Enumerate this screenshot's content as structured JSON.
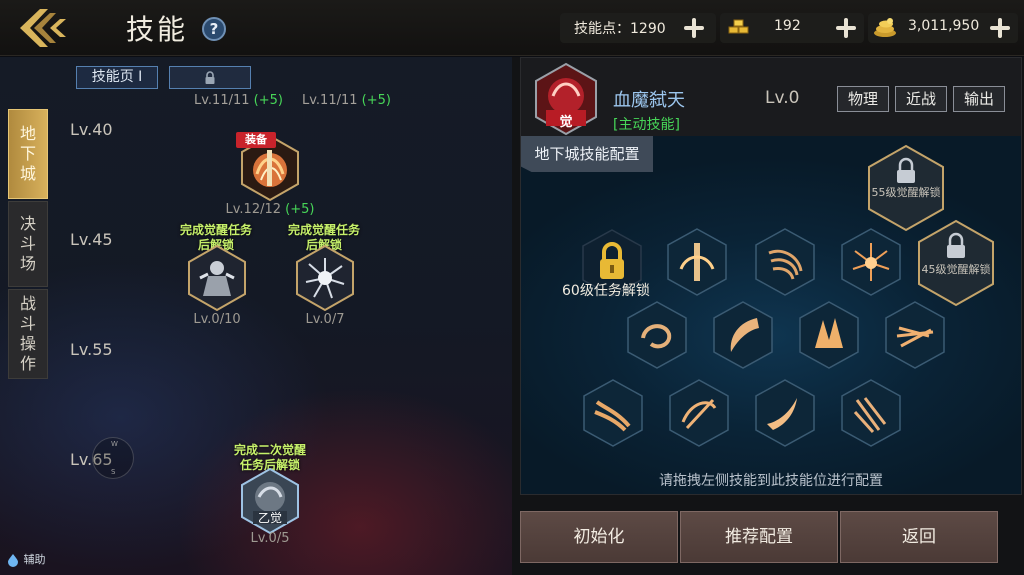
{
  "header": {
    "title": "技能",
    "help_label": "?",
    "skill_points_label": "技能点：1290",
    "gold_value": "192",
    "coin_value": "3,011,950"
  },
  "side_tabs": [
    {
      "label": [
        "地",
        "下",
        "城"
      ],
      "active": true
    },
    {
      "label": [
        "决",
        "斗",
        "场"
      ],
      "active": false
    },
    {
      "label": [
        "战",
        "斗",
        "操",
        "作"
      ],
      "active": false
    }
  ],
  "page_tabs": [
    {
      "label": "技能页 I"
    }
  ],
  "tree": {
    "top_levels": [
      {
        "text": "Lv.11/11",
        "bonus": "(+5)"
      },
      {
        "text": "Lv.11/11",
        "bonus": "(+5)"
      }
    ],
    "level_markers": [
      "Lv.40",
      "Lv.45",
      "Lv.55",
      "Lv.65"
    ],
    "skills": [
      {
        "level": "Lv.12/12",
        "bonus": "(+5)",
        "badge": "装备",
        "caption": "",
        "icon": "blood-slash-skill-icon"
      },
      {
        "level": "Lv.0/10",
        "bonus": "",
        "badge": "",
        "caption": "完成觉醒任务后解锁",
        "icon": "demon-form-skill-icon"
      },
      {
        "level": "Lv.0/7",
        "bonus": "",
        "badge": "",
        "caption": "完成觉醒任务后解锁",
        "icon": "burst-skill-icon"
      },
      {
        "level": "Lv.0/5",
        "bonus": "",
        "badge": "",
        "caption": "完成二次觉醒任务后解锁",
        "icon": "second-awakening-skill-icon"
      }
    ],
    "compass": {
      "n": "W",
      "s": "S"
    },
    "assist_label": "辅助"
  },
  "detail": {
    "skill_name": "血魔弑天",
    "skill_type": "[主动技能]",
    "skill_level": "Lv.0",
    "awaken_badge": "觉",
    "tags": [
      "物理",
      "近战",
      "输出"
    ],
    "config_title": "地下城技能配置",
    "locked_slot_55": "55级觉醒解锁",
    "locked_slot_45": "45级觉醒解锁",
    "quest_lock": "60级任务解锁",
    "hint": "请拖拽左侧技能到此技能位进行配置"
  },
  "buttons": {
    "reset": "初始化",
    "recommend": "推荐配置",
    "back": "返回"
  },
  "colors": {
    "accent_gold": "#d8b15c",
    "level_green": "#47d658",
    "name_blue": "#9cc6ee",
    "unlock_caption": "#c6f06a",
    "badge_red": "#c8232b"
  }
}
